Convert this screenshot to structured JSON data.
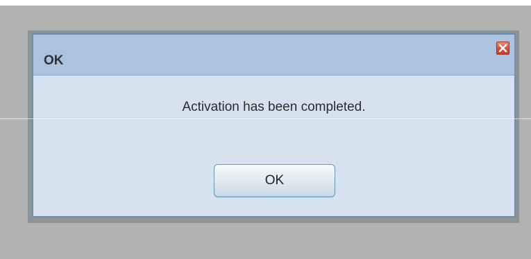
{
  "dialog": {
    "title": "OK",
    "message": "Activation has been completed.",
    "ok_label": "OK"
  },
  "icons": {
    "close": "close-icon"
  },
  "colors": {
    "backdrop": "#b1b2b2",
    "titlebar": "#abc3df",
    "dialog_body": "#d6e2ef",
    "close_button": "#df4f35"
  }
}
